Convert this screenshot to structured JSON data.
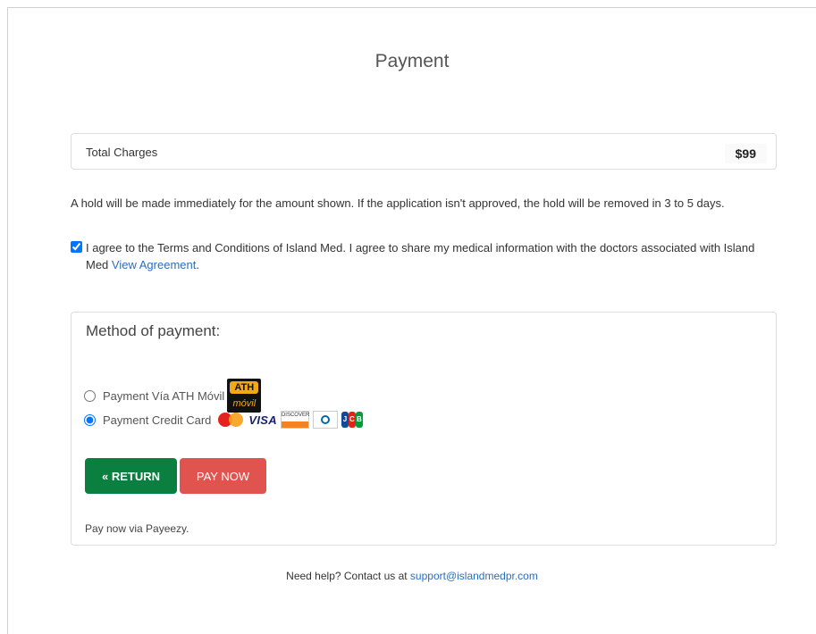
{
  "page": {
    "title": "Payment"
  },
  "charges": {
    "label": "Total Charges",
    "amount": "$99"
  },
  "hold_note": "A hold will be made immediately for the amount shown. If the application isn't approved, the hold will be removed in 3 to 5 days.",
  "agreement": {
    "checked": true,
    "text": "I agree to the Terms and Conditions of Island Med. I agree to share my medical information with the doctors associated with Island Med",
    "link_label": "View Agreement",
    "trailing": "."
  },
  "method": {
    "title": "Method of payment:",
    "options": [
      {
        "label": "Payment Vía ATH Móvil",
        "selected": false,
        "logo_top": "ATH",
        "logo_bottom": "móvil",
        "icon": "ath-movil-logo"
      },
      {
        "label": "Payment Credit Card",
        "selected": true,
        "icons": [
          "mastercard-icon",
          "visa-icon",
          "discover-icon",
          "diners-club-icon",
          "jcb-icon"
        ]
      }
    ],
    "visa_text": "VISA",
    "discover_text": "DISCOVER",
    "jcb_letters": [
      "J",
      "C",
      "B"
    ],
    "return_label": "« RETURN",
    "pay_label": "PAY NOW",
    "footer_note": "Pay now via Payeezy."
  },
  "help": {
    "prefix": "Need help? Contact us at",
    "email": "support@islandmedpr.com"
  },
  "colors": {
    "return_button": "#0b7f3f",
    "pay_button": "#e0534e",
    "link": "#2a6ebb"
  }
}
